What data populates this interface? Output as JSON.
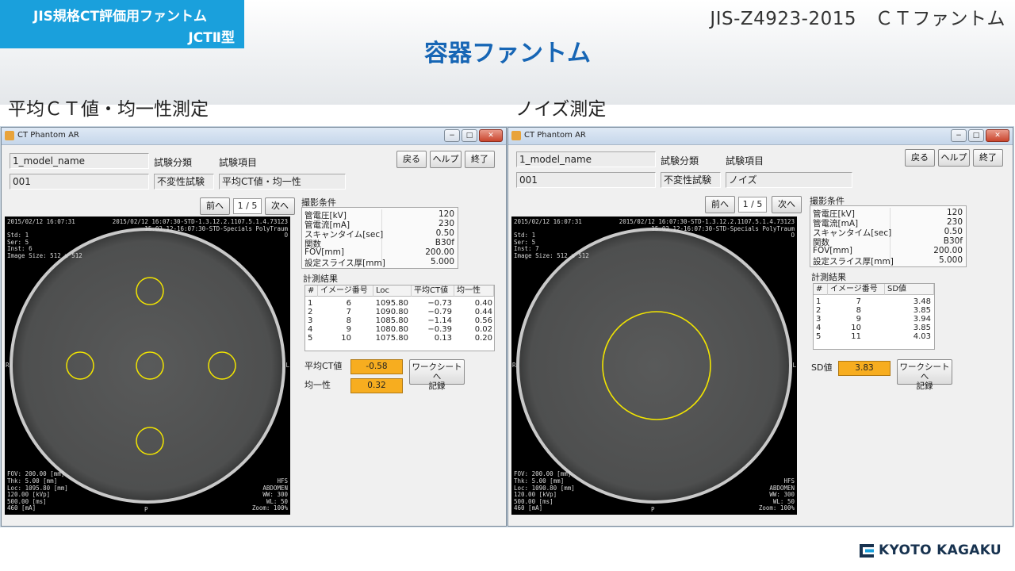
{
  "header": {
    "brand_line1": "JIS規格CT評価用ファントム",
    "brand_line2": "JCTⅡ型",
    "standard_title": "JIS-Z4923-2015　ＣＴファントム",
    "main_title": "容器ファントム"
  },
  "sections": {
    "left_title": "平均ＣＴ値・均一性測定",
    "right_title": "ノイズ測定"
  },
  "colors": {
    "brand": "#1aa0dc",
    "main_title": "#1766b5",
    "roi": "#f2e500",
    "value_box": "#f7ad1f"
  },
  "window_common": {
    "app_title": "CT Phantom AR",
    "back_button": "戻る",
    "help_button": "ヘルプ",
    "exit_button": "終了",
    "model_name": "1_model_name",
    "model_id": "001",
    "test_category_label": "試験分類",
    "test_item_label": "試験項目",
    "test_category_value": "不変性試験",
    "prev_button": "前へ",
    "page_indicator": "1 / 5",
    "next_button": "次へ",
    "conditions_label": "撮影条件",
    "conditions": [
      {
        "key": "管電圧[kV]",
        "value": "120"
      },
      {
        "key": "管電流[mA]",
        "value": "230"
      },
      {
        "key": "スキャンタイム[sec]",
        "value": "0.50"
      },
      {
        "key": "関数",
        "value": "B30f"
      },
      {
        "key": "FOV[mm]",
        "value": "200.00"
      },
      {
        "key": "設定スライス厚[mm]",
        "value": "5.000"
      }
    ],
    "results_label": "計測結果",
    "worksheet_line1": "ワークシートへ",
    "worksheet_line2": "記録"
  },
  "left_window": {
    "test_item_value": "平均CT値・均一性",
    "image": {
      "top_left": [
        "2015/02/12 16:07:31",
        "",
        "Std: 1",
        "Ser: 5",
        "Inst: 6",
        "Image Size: 512 x 512"
      ],
      "top_right": [
        "2015/02/12 16:07:30-STD-1.3.12.2.1107.5.1.4.73123",
        "15.02.12-16:07:30-STD-Specials PolyTraum",
        "O"
      ],
      "bottom_left": [
        "FOV: 200.00 [mm]",
        "Thk: 5.00 [mm]",
        "Loc: 1095.80 [mm]",
        "120.00 [kVp]",
        "500.00 [ms]",
        "460 [mA]"
      ],
      "bottom_right": [
        "HFS",
        "ABDOMEN",
        "WW: 300",
        "WL: 50",
        "Zoom: 100%"
      ],
      "orient_left": "R",
      "orient_right": "L",
      "orient_bottom": "P"
    },
    "results_headers": [
      "#",
      "イメージ番号",
      "Loc",
      "平均CT値",
      "均一性"
    ],
    "results_rows": [
      [
        "1",
        "6",
        "1095.80",
        "−0.73",
        "0.40"
      ],
      [
        "2",
        "7",
        "1090.80",
        "−0.79",
        "0.44"
      ],
      [
        "3",
        "8",
        "1085.80",
        "−1.14",
        "0.56"
      ],
      [
        "4",
        "9",
        "1080.80",
        "−0.39",
        "0.02"
      ],
      [
        "5",
        "10",
        "1075.80",
        "0.13",
        "0.20"
      ]
    ],
    "mean_ct_label": "平均CT値",
    "mean_ct_value": "-0.58",
    "uniformity_label": "均一性",
    "uniformity_value": "0.32"
  },
  "right_window": {
    "test_item_value": "ノイズ",
    "image": {
      "top_left": [
        "2015/02/12 16:07:31",
        "",
        "Std: 1",
        "Ser: 5",
        "Inst: 7",
        "Image Size: 512 x 512"
      ],
      "top_right": [
        "2015/02/12 16:07:30-STD-1.3.12.2.1107.5.1.4.73123",
        "15.02.12-16:07:30-STD-Specials PolyTraum",
        "O"
      ],
      "bottom_left": [
        "FOV: 200.00 [mm]",
        "Thk: 5.00 [mm]",
        "Loc: 1090.80 [mm]",
        "120.00 [kVp]",
        "500.00 [ms]",
        "460 [mA]"
      ],
      "bottom_right": [
        "HFS",
        "ABDOMEN",
        "WW: 300",
        "WL: 50",
        "Zoom: 100%"
      ],
      "orient_left": "R",
      "orient_right": "L",
      "orient_bottom": "P"
    },
    "results_headers": [
      "#",
      "イメージ番号",
      "SD値"
    ],
    "results_rows": [
      [
        "1",
        "7",
        "3.48"
      ],
      [
        "2",
        "8",
        "3.85"
      ],
      [
        "3",
        "9",
        "3.94"
      ],
      [
        "4",
        "10",
        "3.85"
      ],
      [
        "5",
        "11",
        "4.03"
      ]
    ],
    "sd_label": "SD値",
    "sd_value": "3.83"
  },
  "footer": {
    "logo_text": "KYOTO KAGAKU"
  }
}
